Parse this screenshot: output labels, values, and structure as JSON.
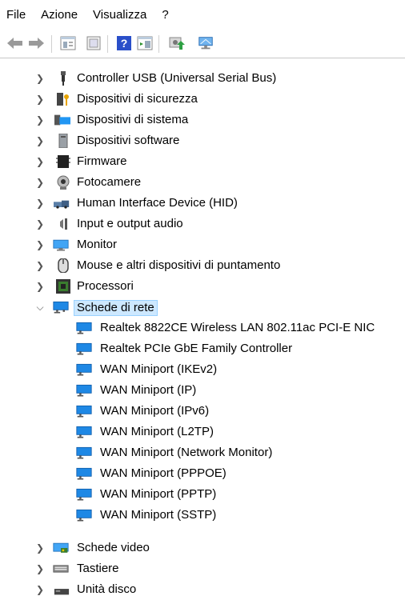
{
  "menu": {
    "file": "File",
    "azione": "Azione",
    "visualizza": "Visualizza",
    "help": "?"
  },
  "toolbar": {
    "buttons": [
      "back-arrow-icon",
      "forward-arrow-icon",
      "properties-grid-icon",
      "show-hide-console-icon",
      "help-icon",
      "action-pane-icon",
      "update-driver-icon",
      "scan-hardware-icon"
    ]
  },
  "tree": {
    "categories": [
      {
        "label": "Controller USB (Universal Serial Bus)",
        "icon": "usb-icon",
        "expanded": false
      },
      {
        "label": "Dispositivi di sicurezza",
        "icon": "security-key-icon",
        "expanded": false
      },
      {
        "label": "Dispositivi di sistema",
        "icon": "system-devices-icon",
        "expanded": false
      },
      {
        "label": "Dispositivi software",
        "icon": "software-device-icon",
        "expanded": false
      },
      {
        "label": "Firmware",
        "icon": "firmware-chip-icon",
        "expanded": false
      },
      {
        "label": "Fotocamere",
        "icon": "camera-icon",
        "expanded": false
      },
      {
        "label": "Human Interface Device (HID)",
        "icon": "hid-icon",
        "expanded": false
      },
      {
        "label": "Input e output audio",
        "icon": "speaker-icon",
        "expanded": false
      },
      {
        "label": "Monitor",
        "icon": "monitor-icon",
        "expanded": false
      },
      {
        "label": "Mouse e altri dispositivi di puntamento",
        "icon": "mouse-icon",
        "expanded": false
      },
      {
        "label": "Processori",
        "icon": "processor-icon",
        "expanded": false
      },
      {
        "label": "Schede di rete",
        "icon": "network-adapter-icon",
        "expanded": true,
        "selected": true
      },
      {
        "label": "Schede video",
        "icon": "display-adapter-icon",
        "expanded": false
      },
      {
        "label": "Tastiere",
        "icon": "keyboard-icon",
        "expanded": false
      },
      {
        "label": "Unità disco",
        "icon": "disk-drive-icon",
        "expanded": false
      }
    ],
    "network_children": [
      "Realtek 8822CE Wireless LAN 802.11ac PCI-E NIC",
      "Realtek PCIe GbE Family Controller",
      "WAN Miniport (IKEv2)",
      "WAN Miniport (IP)",
      "WAN Miniport (IPv6)",
      "WAN Miniport (L2TP)",
      "WAN Miniport (Network Monitor)",
      "WAN Miniport (PPPOE)",
      "WAN Miniport (PPTP)",
      "WAN Miniport (SSTP)"
    ]
  },
  "colors": {
    "selection": "#cde8ff",
    "selection_border": "#99d1ff",
    "net_blue": "#1e88e5"
  }
}
